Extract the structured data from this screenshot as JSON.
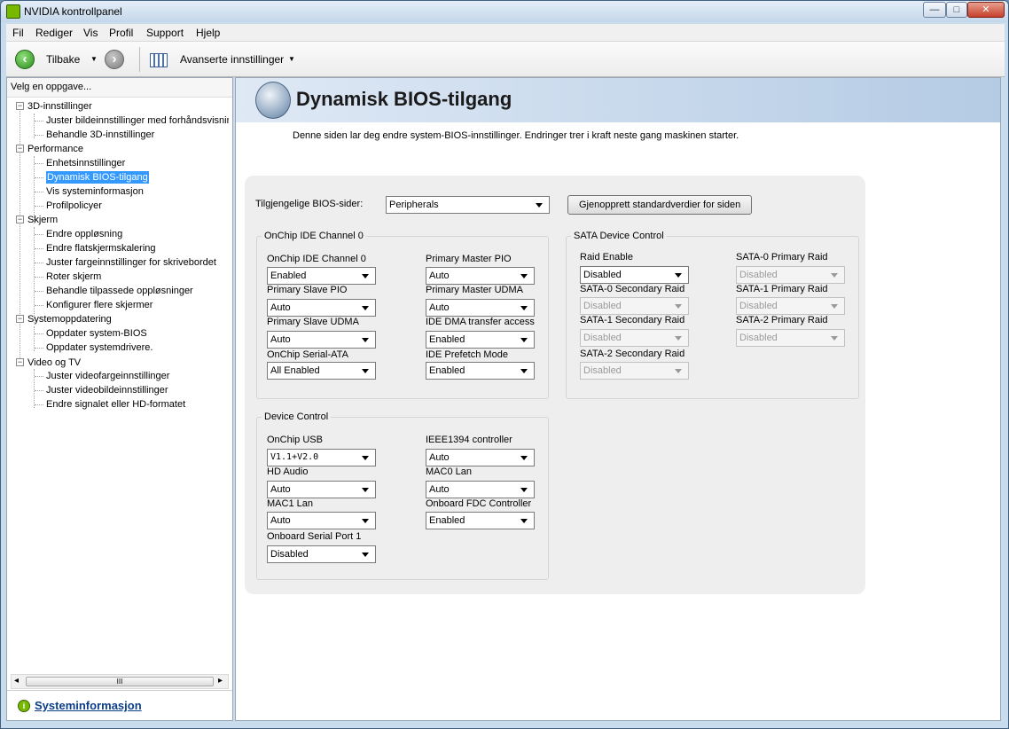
{
  "window": {
    "title": "NVIDIA kontrollpanel",
    "min_glyph": "—",
    "max_glyph": "□",
    "close_glyph": "✕"
  },
  "menu": [
    "Fil",
    "Rediger",
    "Vis",
    "Profil",
    "Support",
    "Hjelp"
  ],
  "toolbar": {
    "back_label": "Tilbake",
    "back_glyph": "‹",
    "forward_glyph": "›",
    "dropdown_glyph": "▼",
    "advanced_label": "Avanserte innstillinger"
  },
  "left": {
    "header": "Velg en oppgave...",
    "tree": [
      {
        "label": "3D-innstillinger",
        "toggle": "−"
      },
      {
        "label": "Juster bildeinnstillinger med forhåndsvisning"
      },
      {
        "label": "Behandle 3D-innstillinger"
      },
      {
        "label": "Performance",
        "toggle": "−"
      },
      {
        "label": "Enhetsinnstillinger"
      },
      {
        "label": "Dynamisk BIOS-tilgang"
      },
      {
        "label": "Vis systeminformasjon"
      },
      {
        "label": "Profilpolicyer"
      },
      {
        "label": "Skjerm",
        "toggle": "−"
      },
      {
        "label": "Endre oppløsning"
      },
      {
        "label": "Endre flatskjermskalering"
      },
      {
        "label": "Juster fargeinnstillinger for skrivebordet"
      },
      {
        "label": "Roter skjerm"
      },
      {
        "label": "Behandle tilpassede oppløsninger"
      },
      {
        "label": "Konfigurer flere skjermer"
      },
      {
        "label": "Systemoppdatering",
        "toggle": "−"
      },
      {
        "label": "Oppdater system-BIOS"
      },
      {
        "label": "Oppdater systemdrivere."
      },
      {
        "label": "Video og TV",
        "toggle": "−"
      },
      {
        "label": "Juster videofargeinnstillinger"
      },
      {
        "label": "Juster videobildeinnstillinger"
      },
      {
        "label": "Endre signalet eller HD-formatet"
      }
    ],
    "scroll_left": "◂",
    "scroll_right": "▸",
    "scroll_grip": "III",
    "footer_link": "Systeminformasjon",
    "footer_icon_glyph": "i"
  },
  "main": {
    "title": "Dynamisk BIOS-tilgang",
    "description": "Denne siden lar deg endre system-BIOS-innstillinger.  Endringer trer i kraft neste gang maskinen starter.",
    "bios_pages_label": "Tilgjengelige BIOS-sider:",
    "bios_pages_value": "Peripherals",
    "restore_button": "Gjenopprett standardverdier for siden",
    "onchip_group": {
      "title": "OnChip IDE Channel 0",
      "fields": [
        {
          "label": "OnChip IDE Channel 0",
          "value": "Enabled"
        },
        {
          "label": "Primary Master PIO",
          "value": "Auto"
        },
        {
          "label": "Primary Slave PIO",
          "value": "Auto"
        },
        {
          "label": "Primary Master UDMA",
          "value": "Auto"
        },
        {
          "label": "Primary Slave UDMA",
          "value": "Auto"
        },
        {
          "label": "IDE DMA transfer access",
          "value": "Enabled"
        },
        {
          "label": "OnChip Serial-ATA",
          "value": "All Enabled"
        },
        {
          "label": "IDE Prefetch Mode",
          "value": "Enabled"
        }
      ]
    },
    "sata_group": {
      "title": "SATA Device Control",
      "fields": [
        {
          "label": "Raid Enable",
          "value": "Disabled",
          "disabled": false
        },
        {
          "label": "SATA-0 Primary Raid",
          "value": "Disabled",
          "disabled": true
        },
        {
          "label": "SATA-0 Secondary Raid",
          "value": "Disabled",
          "disabled": true
        },
        {
          "label": "SATA-1 Primary Raid",
          "value": "Disabled",
          "disabled": true
        },
        {
          "label": "SATA-1 Secondary Raid",
          "value": "Disabled",
          "disabled": true
        },
        {
          "label": "SATA-2 Primary Raid",
          "value": "Disabled",
          "disabled": true
        },
        {
          "label": "SATA-2 Secondary Raid",
          "value": "Disabled",
          "disabled": true
        }
      ]
    },
    "device_group": {
      "title": "Device Control",
      "fields": [
        {
          "label": "OnChip USB",
          "value": "V1.1+V2.0"
        },
        {
          "label": "IEEE1394 controller",
          "value": "Auto"
        },
        {
          "label": "HD Audio",
          "value": "Auto"
        },
        {
          "label": "MAC0 Lan",
          "value": "Auto"
        },
        {
          "label": "MAC1 Lan",
          "value": "Auto"
        },
        {
          "label": "Onboard FDC Controller",
          "value": "Enabled"
        },
        {
          "label": "Onboard Serial Port 1",
          "value": "Disabled"
        }
      ]
    }
  },
  "colors": {
    "accent": "#76b900",
    "selection": "#3399ff",
    "link": "#0b3e8a"
  }
}
